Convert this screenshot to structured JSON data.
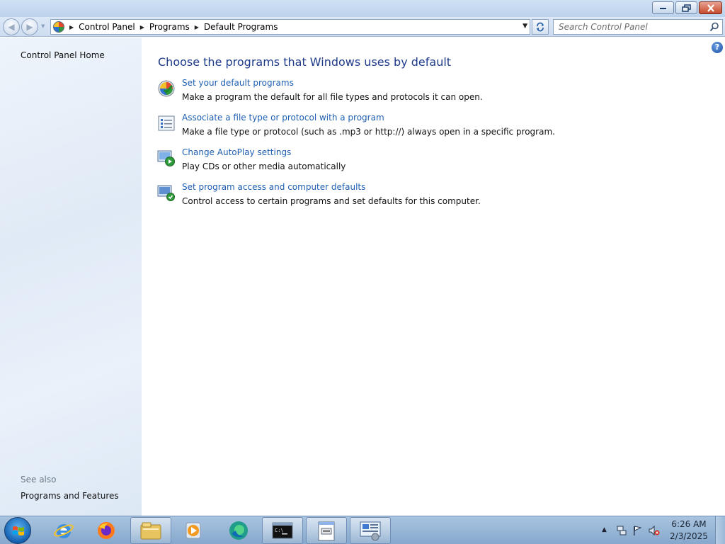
{
  "window": {
    "controls": {
      "minimize": "minimize",
      "restore": "restore",
      "close": "close"
    }
  },
  "navigation": {
    "breadcrumb": [
      "Control Panel",
      "Programs",
      "Default Programs"
    ],
    "search_placeholder": "Search Control Panel"
  },
  "left_pane": {
    "home_link": "Control Panel Home",
    "see_also_heading": "See also",
    "see_also_links": [
      "Programs and Features"
    ]
  },
  "main": {
    "title": "Choose the programs that Windows uses by default",
    "tasks": [
      {
        "icon": "default-programs-icon",
        "link": "Set your default programs",
        "description": "Make a program the default for all file types and protocols it can open."
      },
      {
        "icon": "file-association-icon",
        "link": "Associate a file type or protocol with a program",
        "description": "Make a file type or protocol (such as .mp3 or http://) always open in a specific program."
      },
      {
        "icon": "autoplay-icon",
        "link": "Change AutoPlay settings",
        "description": "Play CDs or other media automatically"
      },
      {
        "icon": "program-access-icon",
        "link": "Set program access and computer defaults",
        "description": "Control access to certain programs and set defaults for this computer."
      }
    ]
  },
  "taskbar": {
    "pinned": [
      "internet-explorer-icon",
      "firefox-icon",
      "file-explorer-icon",
      "media-player-icon",
      "edge-icon",
      "command-prompt-icon",
      "notepad-icon",
      "control-panel-icon"
    ],
    "clock": {
      "time": "6:26 AM",
      "date": "2/3/2025"
    }
  },
  "colors": {
    "link": "#1e5fb3",
    "title": "#1e3a8a",
    "left_pane_bg": "#e5eef8",
    "taskbar": "#9db9d9"
  }
}
